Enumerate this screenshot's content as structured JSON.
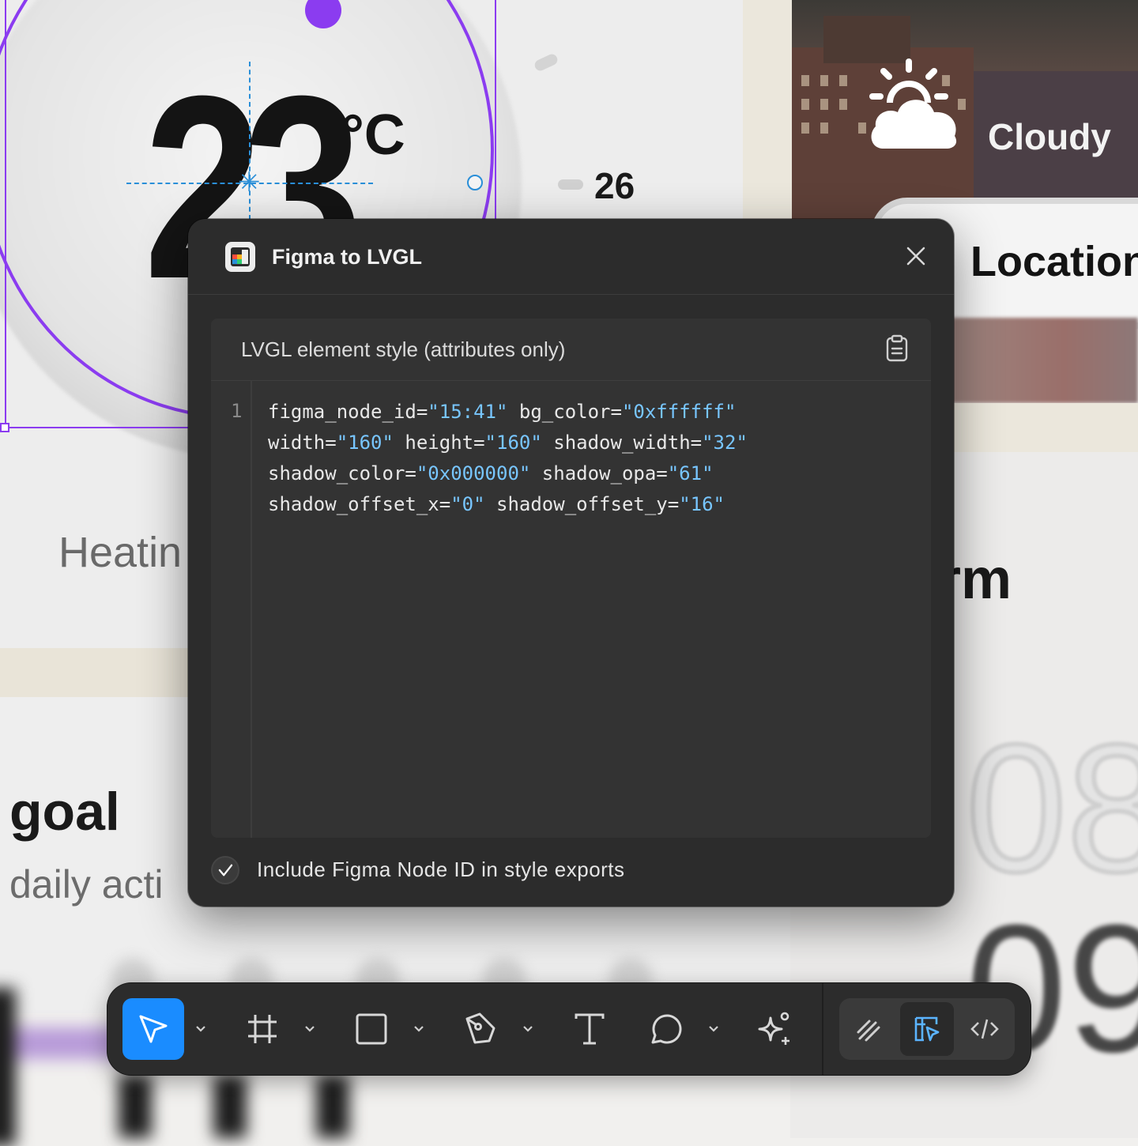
{
  "canvas": {
    "temperature_value": "23",
    "temperature_unit": "°C",
    "dial_tick_value": "26",
    "heating_label": "Heatin",
    "goal_label": "goal",
    "daily_label": "daily acti",
    "weather_condition": "Cloudy",
    "location_label": "Location",
    "warm_label": "rm",
    "clock_top": "08",
    "clock_bottom": "09"
  },
  "dialog": {
    "title": "Figma to LVGL",
    "panel_title": "LVGL element style (attributes only)",
    "line_number": "1",
    "code_lines": [
      [
        [
          "figma_node_id=",
          "k"
        ],
        [
          "\"15:41\"",
          "v"
        ],
        [
          " bg_color=",
          "k"
        ],
        [
          "\"0xffffff\"",
          "v"
        ]
      ],
      [
        [
          "width=",
          "k"
        ],
        [
          "\"160\"",
          "v"
        ],
        [
          " height=",
          "k"
        ],
        [
          "\"160\"",
          "v"
        ],
        [
          " shadow_width=",
          "k"
        ],
        [
          "\"32\"",
          "v"
        ]
      ],
      [
        [
          "shadow_color=",
          "k"
        ],
        [
          "\"0x000000\"",
          "v"
        ],
        [
          " shadow_opa=",
          "k"
        ],
        [
          "\"61\"",
          "v"
        ]
      ],
      [
        [
          "shadow_offset_x=",
          "k"
        ],
        [
          "\"0\"",
          "v"
        ],
        [
          " shadow_offset_y=",
          "k"
        ],
        [
          "\"16\"",
          "v"
        ]
      ]
    ],
    "include_node_id": {
      "label": "Include Figma Node ID in style exports",
      "checked": true
    }
  },
  "toolbar": {
    "tools": [
      "move-tool",
      "frame-tool",
      "rectangle-tool",
      "pen-tool",
      "text-tool",
      "comment-tool",
      "actions-tool"
    ],
    "active_tool": "move-tool",
    "modes": [
      "draw-mode",
      "design-mode",
      "dev-mode"
    ],
    "active_mode": "design-mode"
  },
  "colors": {
    "accent": "#1a8cff",
    "selection": "#8b3cf0",
    "guide": "#2a8fd8",
    "code_value": "#78c6ff",
    "dialog_bg": "#2c2c2c"
  }
}
